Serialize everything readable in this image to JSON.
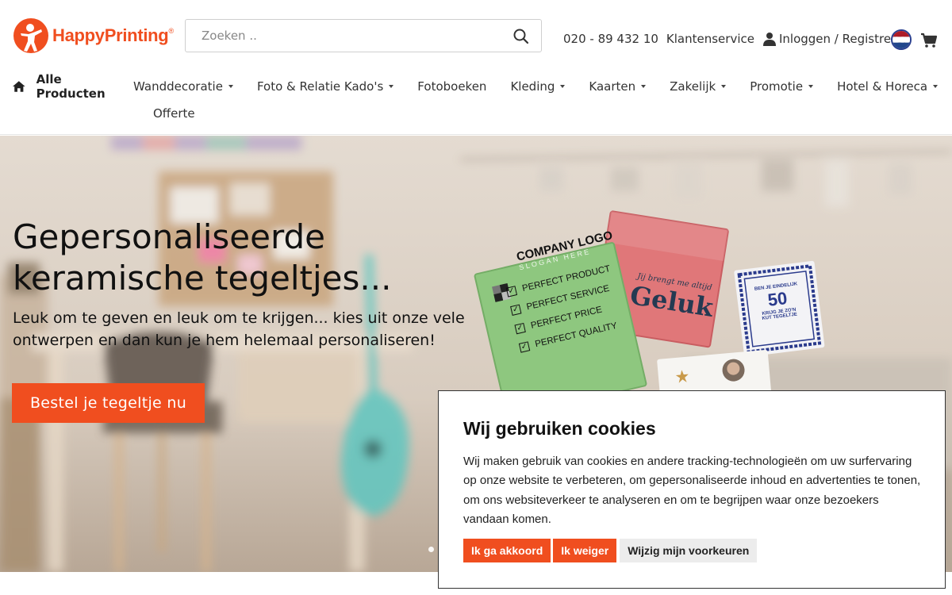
{
  "brand": {
    "name": "HappyPrinting",
    "trademark": "®",
    "accent": "#f04e1f"
  },
  "search": {
    "placeholder": "Zoeken ..",
    "value": ""
  },
  "topbar": {
    "phone": "020 - 89 432 10",
    "service": "Klantenservice",
    "login": "Inloggen / Registreren",
    "flag_icon": "netherlands-flag-icon",
    "cart_icon": "cart-icon"
  },
  "nav": {
    "home": "Alle Producten",
    "items": [
      {
        "label": "Wanddecoratie",
        "has_dropdown": true
      },
      {
        "label": "Foto & Relatie Kado's",
        "has_dropdown": true
      },
      {
        "label": "Fotoboeken",
        "has_dropdown": false
      },
      {
        "label": "Kleding",
        "has_dropdown": true
      },
      {
        "label": "Kaarten",
        "has_dropdown": true
      },
      {
        "label": "Zakelijk",
        "has_dropdown": true
      },
      {
        "label": "Promotie",
        "has_dropdown": true
      },
      {
        "label": "Hotel & Horeca",
        "has_dropdown": true
      }
    ],
    "second_row": "Offerte"
  },
  "hero": {
    "title_line1": "Gepersonaliseerde",
    "title_line2": "keramische tegeltjes...",
    "subtitle_line1": "Leuk om te geven en leuk om te krijgen... kies uit onze vele",
    "subtitle_line2": "ontwerpen en dan kun je hem helemaal personaliseren!",
    "cta": "Bestel je tegeltje nu",
    "tiles": {
      "green": {
        "logo": "COMPANY LOGO",
        "slogan": "SLOGAN HERE",
        "items": [
          "PERFECT PRODUCT",
          "PERFECT SERVICE",
          "PERFECT PRICE",
          "PERFECT QUALITY"
        ]
      },
      "red": {
        "script": "Jij brengt me altijd",
        "word": "Geluk"
      },
      "blue": {
        "top": "BEN JE EINDELIJK",
        "number": "50",
        "bottom1": "KRIJG JE ZO'N",
        "bottom2": "KUT TEGELTJE"
      }
    }
  },
  "cookie": {
    "title": "Wij gebruiken cookies",
    "text": "Wij maken gebruik van cookies en andere tracking-technologieën om uw surfervaring op onze website te verbeteren, om gepersonaliseerde inhoud en advertenties te tonen, om ons websiteverkeer te analyseren en om te begrijpen waar onze bezoekers vandaan komen.",
    "accept": "Ik ga akkoord",
    "reject": "Ik weiger",
    "preferences": "Wijzig mijn voorkeuren"
  }
}
